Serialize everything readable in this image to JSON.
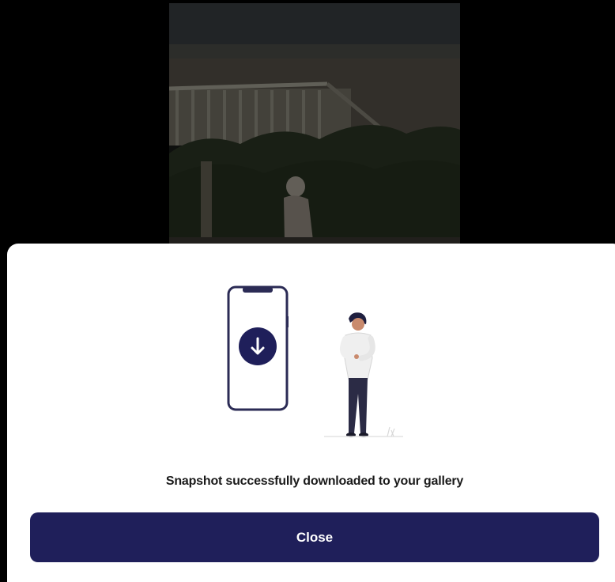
{
  "dialog": {
    "message": "Snapshot successfully downloaded to your gallery",
    "close_label": "Close"
  },
  "icons": {
    "download": "arrow-down-icon"
  },
  "colors": {
    "primary": "#1f1f5a",
    "sheet_background": "#ffffff",
    "backdrop": "#000000"
  }
}
